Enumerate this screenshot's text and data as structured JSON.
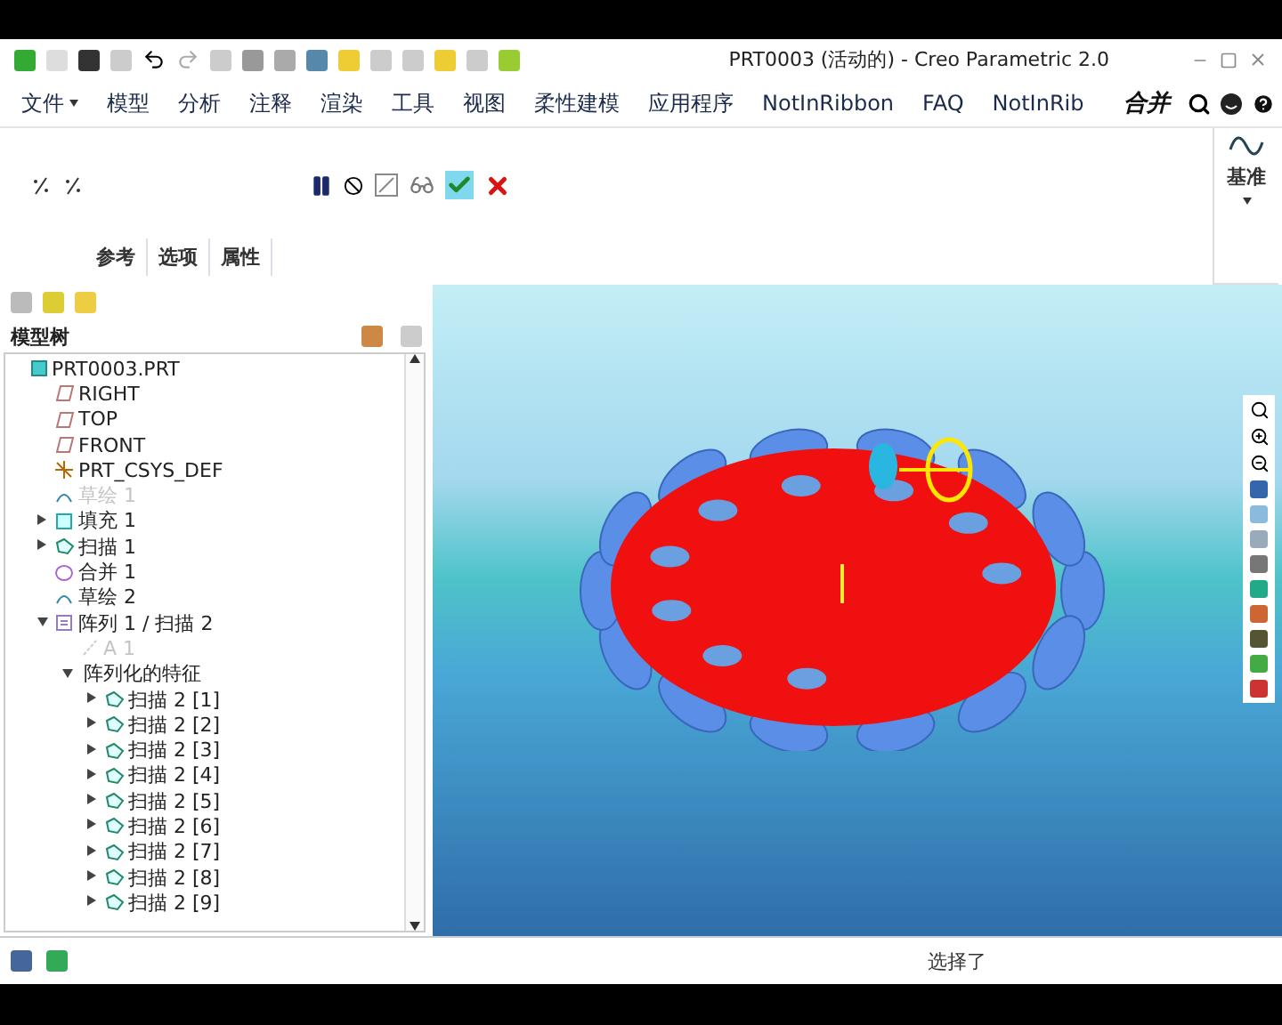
{
  "window": {
    "title": "PRT0003 (活动的) - Creo Parametric 2.0"
  },
  "ribbon_tabs": [
    {
      "label": "文件",
      "selected": false,
      "has_menu": true
    },
    {
      "label": "模型",
      "selected": false,
      "has_menu": false
    },
    {
      "label": "分析",
      "selected": false,
      "has_menu": false
    },
    {
      "label": "注释",
      "selected": false,
      "has_menu": false
    },
    {
      "label": "渲染",
      "selected": false,
      "has_menu": false
    },
    {
      "label": "工具",
      "selected": false,
      "has_menu": false
    },
    {
      "label": "视图",
      "selected": false,
      "has_menu": false
    },
    {
      "label": "柔性建模",
      "selected": false,
      "has_menu": false
    },
    {
      "label": "应用程序",
      "selected": false,
      "has_menu": false
    },
    {
      "label": "NotInRibbon",
      "selected": false,
      "has_menu": false
    },
    {
      "label": "FAQ",
      "selected": false,
      "has_menu": false
    },
    {
      "label": "NotInRib",
      "selected": false,
      "has_menu": false
    }
  ],
  "active_feature_label": "合并",
  "datum_group": {
    "label": "基准"
  },
  "dashboard_tabs": [
    {
      "label": "参考",
      "selected": false
    },
    {
      "label": "选项",
      "selected": false
    },
    {
      "label": "属性",
      "selected": false
    }
  ],
  "model_tree": {
    "title": "模型树",
    "items": [
      {
        "label": "PRT0003.PRT",
        "kind": "part",
        "dimmed": false,
        "children": [
          {
            "label": "RIGHT",
            "kind": "plane",
            "dimmed": false
          },
          {
            "label": "TOP",
            "kind": "plane",
            "dimmed": false
          },
          {
            "label": "FRONT",
            "kind": "plane",
            "dimmed": false
          },
          {
            "label": "PRT_CSYS_DEF",
            "kind": "csys",
            "dimmed": false
          },
          {
            "label": "草绘 1",
            "kind": "sketch",
            "dimmed": true
          },
          {
            "label": "填充 1",
            "kind": "fill",
            "dimmed": false,
            "expanded": false
          },
          {
            "label": "扫描 1",
            "kind": "sweep",
            "dimmed": false,
            "expanded": false
          },
          {
            "label": "合并 1",
            "kind": "merge",
            "dimmed": false
          },
          {
            "label": "草绘 2",
            "kind": "sketch",
            "dimmed": false
          },
          {
            "label": "阵列 1 / 扫描 2",
            "kind": "pattern",
            "dimmed": false,
            "expanded": true,
            "children": [
              {
                "label": "A 1",
                "kind": "axis",
                "dimmed": true
              },
              {
                "label": "阵列化的特征",
                "kind": "group",
                "dimmed": false,
                "expanded": true,
                "children": [
                  {
                    "label": "扫描 2 [1]",
                    "kind": "sweep",
                    "dimmed": false,
                    "expanded": false
                  },
                  {
                    "label": "扫描 2 [2]",
                    "kind": "sweep",
                    "dimmed": false,
                    "expanded": false
                  },
                  {
                    "label": "扫描 2 [3]",
                    "kind": "sweep",
                    "dimmed": false,
                    "expanded": false
                  },
                  {
                    "label": "扫描 2 [4]",
                    "kind": "sweep",
                    "dimmed": false,
                    "expanded": false
                  },
                  {
                    "label": "扫描 2 [5]",
                    "kind": "sweep",
                    "dimmed": false,
                    "expanded": false
                  },
                  {
                    "label": "扫描 2 [6]",
                    "kind": "sweep",
                    "dimmed": false,
                    "expanded": false
                  },
                  {
                    "label": "扫描 2 [7]",
                    "kind": "sweep",
                    "dimmed": false,
                    "expanded": false
                  },
                  {
                    "label": "扫描 2 [8]",
                    "kind": "sweep",
                    "dimmed": false,
                    "expanded": false
                  },
                  {
                    "label": "扫描 2 [9]",
                    "kind": "sweep",
                    "dimmed": false,
                    "expanded": false
                  }
                ]
              }
            ]
          }
        ]
      }
    ]
  },
  "status_bar": {
    "message": "选择了"
  }
}
